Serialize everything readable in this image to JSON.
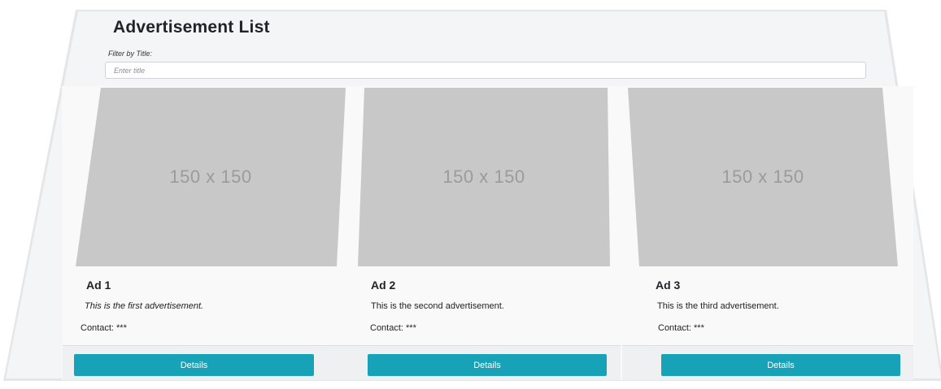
{
  "header": {
    "title": "Advertisement List"
  },
  "filter": {
    "label": "Filter by Title:",
    "placeholder": "Enter title",
    "value": ""
  },
  "ads": [
    {
      "title": "Ad 1",
      "image_text": "150 x 150",
      "description": "This is the first advertisement.",
      "contact": "Contact: ***",
      "button_label": "Details"
    },
    {
      "title": "Ad 2",
      "image_text": "150 x 150",
      "description": "This is the second advertisement.",
      "contact": "Contact: ***",
      "button_label": "Details"
    },
    {
      "title": "Ad 3",
      "image_text": "150 x 150",
      "description": "This is the third advertisement.",
      "contact": "Contact: ***",
      "button_label": "Details"
    }
  ],
  "colors": {
    "button": "#17a2b8",
    "placeholder": "#c8c8c8"
  }
}
